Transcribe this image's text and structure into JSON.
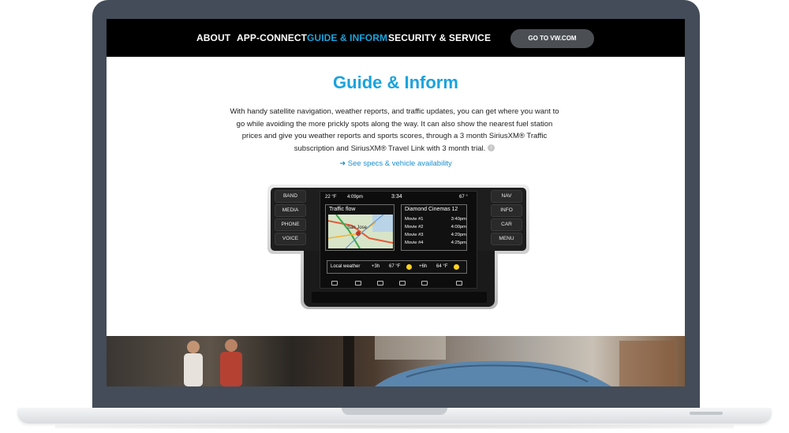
{
  "nav": {
    "links": [
      "ABOUT",
      "APP-CONNECT",
      "GUIDE & INFORM",
      "SECURITY & SERVICE"
    ],
    "active_index": 2,
    "cta_label": "GO TO VW.COM"
  },
  "content": {
    "title": "Guide & Inform",
    "description": "With handy satellite navigation, weather reports, and traffic updates, you can get where you want to go while avoiding the more prickly spots along the way. It can also show the nearest fuel station prices and give you weather reports and sports scores, through a 3 month SiriusXM® Traffic subscription and SiriusXM® Travel Link with 3 month trial.",
    "info_icon": "i",
    "specs_link": "➜ See specs & vehicle availability"
  },
  "device": {
    "left_buttons": [
      "BAND",
      "MEDIA",
      "PHONE",
      "VOICE"
    ],
    "right_buttons": [
      "NAV",
      "INFO",
      "CAR",
      "MENU"
    ],
    "status": {
      "temp_left": "22 °F",
      "clock": "4:09pm",
      "center": "3:34",
      "temp_right": "67 °"
    },
    "traffic_panel": {
      "title": "Traffic flow",
      "map_label": "San Jose"
    },
    "movies_panel": {
      "title": "Diamond Cinemas 12",
      "rows": [
        {
          "name": "Movie #1",
          "time": "3:40pm"
        },
        {
          "name": "Movie #2",
          "time": "4:00pm"
        },
        {
          "name": "Movie #3",
          "time": "4:20pm"
        },
        {
          "name": "Movie #4",
          "time": "4:25pm"
        }
      ]
    },
    "weather": {
      "label": "Local weather",
      "f1_hours": "+3h",
      "f1_temp": "67 °F",
      "f2_hours": "+6h",
      "f2_temp": "64 °F"
    }
  },
  "colors": {
    "accent": "#1aa3dd",
    "nav_bg": "#000000",
    "bezel": "#434c58"
  }
}
